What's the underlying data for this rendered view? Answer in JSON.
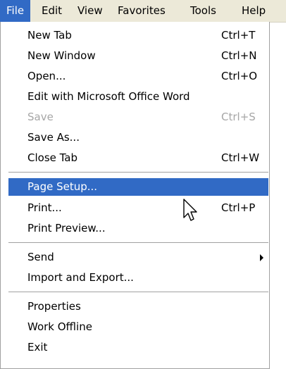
{
  "menubar": {
    "items": [
      "File",
      "Edit",
      "View",
      "Favorites",
      "Tools",
      "Help"
    ],
    "active": "File"
  },
  "file_menu": {
    "items": [
      {
        "label": "New Tab",
        "shortcut": "Ctrl+T"
      },
      {
        "label": "New Window",
        "shortcut": "Ctrl+N"
      },
      {
        "label": "Open...",
        "shortcut": "Ctrl+O"
      },
      {
        "label": "Edit with Microsoft Office Word",
        "shortcut": ""
      },
      {
        "label": "Save",
        "shortcut": "Ctrl+S",
        "disabled": true
      },
      {
        "label": "Save As...",
        "shortcut": ""
      },
      {
        "label": "Close Tab",
        "shortcut": "Ctrl+W"
      },
      {
        "label": "Page Setup...",
        "shortcut": "",
        "highlighted": true
      },
      {
        "label": "Print...",
        "shortcut": "Ctrl+P"
      },
      {
        "label": "Print Preview...",
        "shortcut": ""
      },
      {
        "label": "Send",
        "shortcut": "",
        "submenu": true
      },
      {
        "label": "Import and Export...",
        "shortcut": ""
      },
      {
        "label": "Properties",
        "shortcut": ""
      },
      {
        "label": "Work Offline",
        "shortcut": ""
      },
      {
        "label": "Exit",
        "shortcut": ""
      }
    ]
  },
  "colors": {
    "highlight": "#316ac5",
    "menubar_bg": "#ece9d8",
    "disabled_text": "#a6a6a6"
  },
  "icons": {
    "submenu": "chevron-right-icon",
    "cursor": "mouse-pointer-icon"
  }
}
